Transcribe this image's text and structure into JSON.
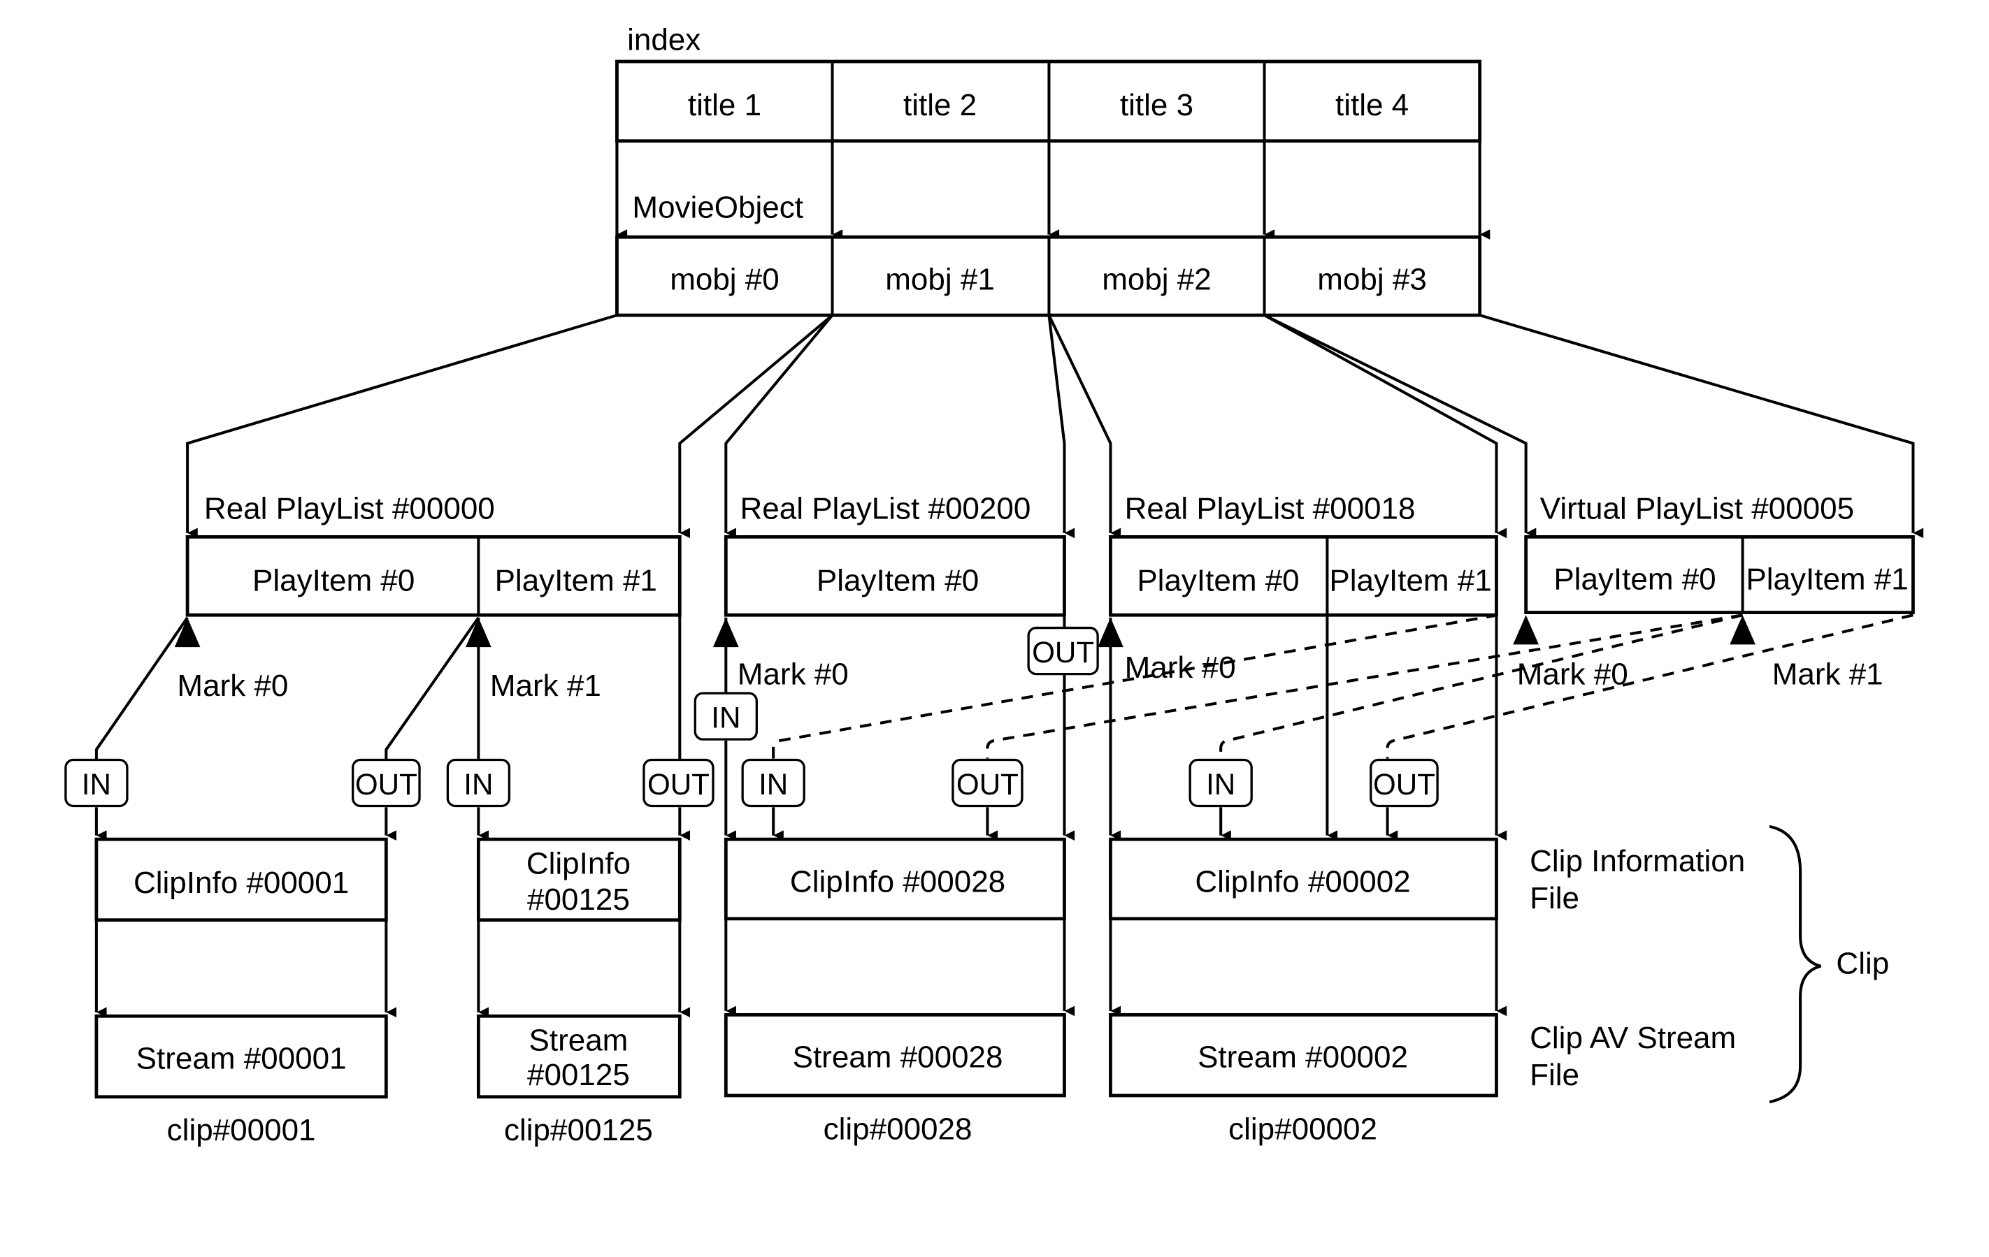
{
  "index": {
    "label": "index",
    "titles": [
      "title 1",
      "title 2",
      "title 3",
      "title 4"
    ],
    "movie_object_label": "MovieObject",
    "mobjs": [
      "mobj #0",
      "mobj #1",
      "mobj #2",
      "mobj #3"
    ]
  },
  "playlists": [
    {
      "label": "Real PlayList #00000",
      "items": [
        "PlayItem #0",
        "PlayItem #1"
      ],
      "marks": [
        "Mark #0",
        "Mark #1"
      ]
    },
    {
      "label": "Real PlayList #00200",
      "items": [
        "PlayItem #0"
      ],
      "marks": [
        "Mark #0"
      ]
    },
    {
      "label": "Real PlayList #00018",
      "items": [
        "PlayItem #0",
        "PlayItem #1"
      ],
      "marks": [
        "Mark #0"
      ]
    },
    {
      "label": "Virtual PlayList #00005",
      "items": [
        "PlayItem #0",
        "PlayItem #1"
      ],
      "marks": [
        "Mark #0",
        "Mark #1"
      ]
    }
  ],
  "tags": {
    "in": "IN",
    "out": "OUT"
  },
  "clips": [
    {
      "info": [
        "ClipInfo #00001"
      ],
      "stream": [
        "Stream #00001"
      ],
      "name": "clip#00001"
    },
    {
      "info": [
        "ClipInfo",
        "#00125"
      ],
      "stream": [
        "Stream",
        "#00125"
      ],
      "name": "clip#00125"
    },
    {
      "info": [
        "ClipInfo #00028"
      ],
      "stream": [
        "Stream #00028"
      ],
      "name": "clip#00028"
    },
    {
      "info": [
        "ClipInfo #00002"
      ],
      "stream": [
        "Stream #00002"
      ],
      "name": "clip#00002"
    }
  ],
  "legend": {
    "clip_info_file": [
      "Clip Information",
      "File"
    ],
    "clip_av_stream_file": [
      "Clip AV Stream",
      "File"
    ],
    "clip": "Clip"
  }
}
